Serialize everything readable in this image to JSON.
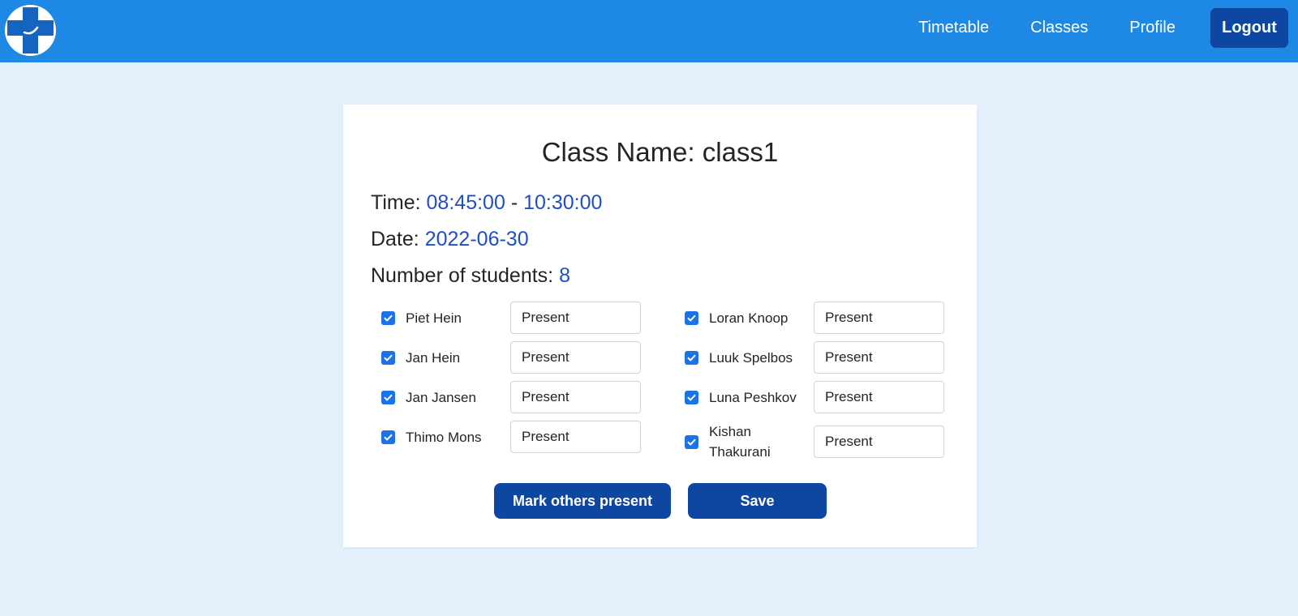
{
  "nav": {
    "links": [
      "Timetable",
      "Classes",
      "Profile"
    ],
    "logout_label": "Logout"
  },
  "class_info": {
    "title": "Class Name: class1",
    "time_label": "Time:",
    "time_start": "08:45:00",
    "time_separator": "-",
    "time_end": "10:30:00",
    "date_label": "Date:",
    "date": "2022-06-30",
    "students_label": "Number of students:",
    "students_count": "8"
  },
  "students": [
    {
      "name": "Piet Hein",
      "status": "Present",
      "checked": true
    },
    {
      "name": "Jan Hein",
      "status": "Present",
      "checked": true
    },
    {
      "name": "Jan Jansen",
      "status": "Present",
      "checked": true
    },
    {
      "name": "Thimo Mons",
      "status": "Present",
      "checked": true
    },
    {
      "name": "Loran Knoop",
      "status": "Present",
      "checked": true
    },
    {
      "name": "Luuk Spelbos",
      "status": "Present",
      "checked": true
    },
    {
      "name": "Luna Peshkov",
      "status": "Present",
      "checked": true
    },
    {
      "name": "Kishan Thakurani",
      "status": "Present",
      "checked": true
    }
  ],
  "buttons": {
    "mark_present": "Mark others present",
    "save": "Save"
  },
  "colors": {
    "navbar": "#1e88e5",
    "background": "#e3f0fc",
    "primary_button": "#0d47a1",
    "value_text": "#1d4fc2",
    "checkbox": "#1a73e8"
  }
}
